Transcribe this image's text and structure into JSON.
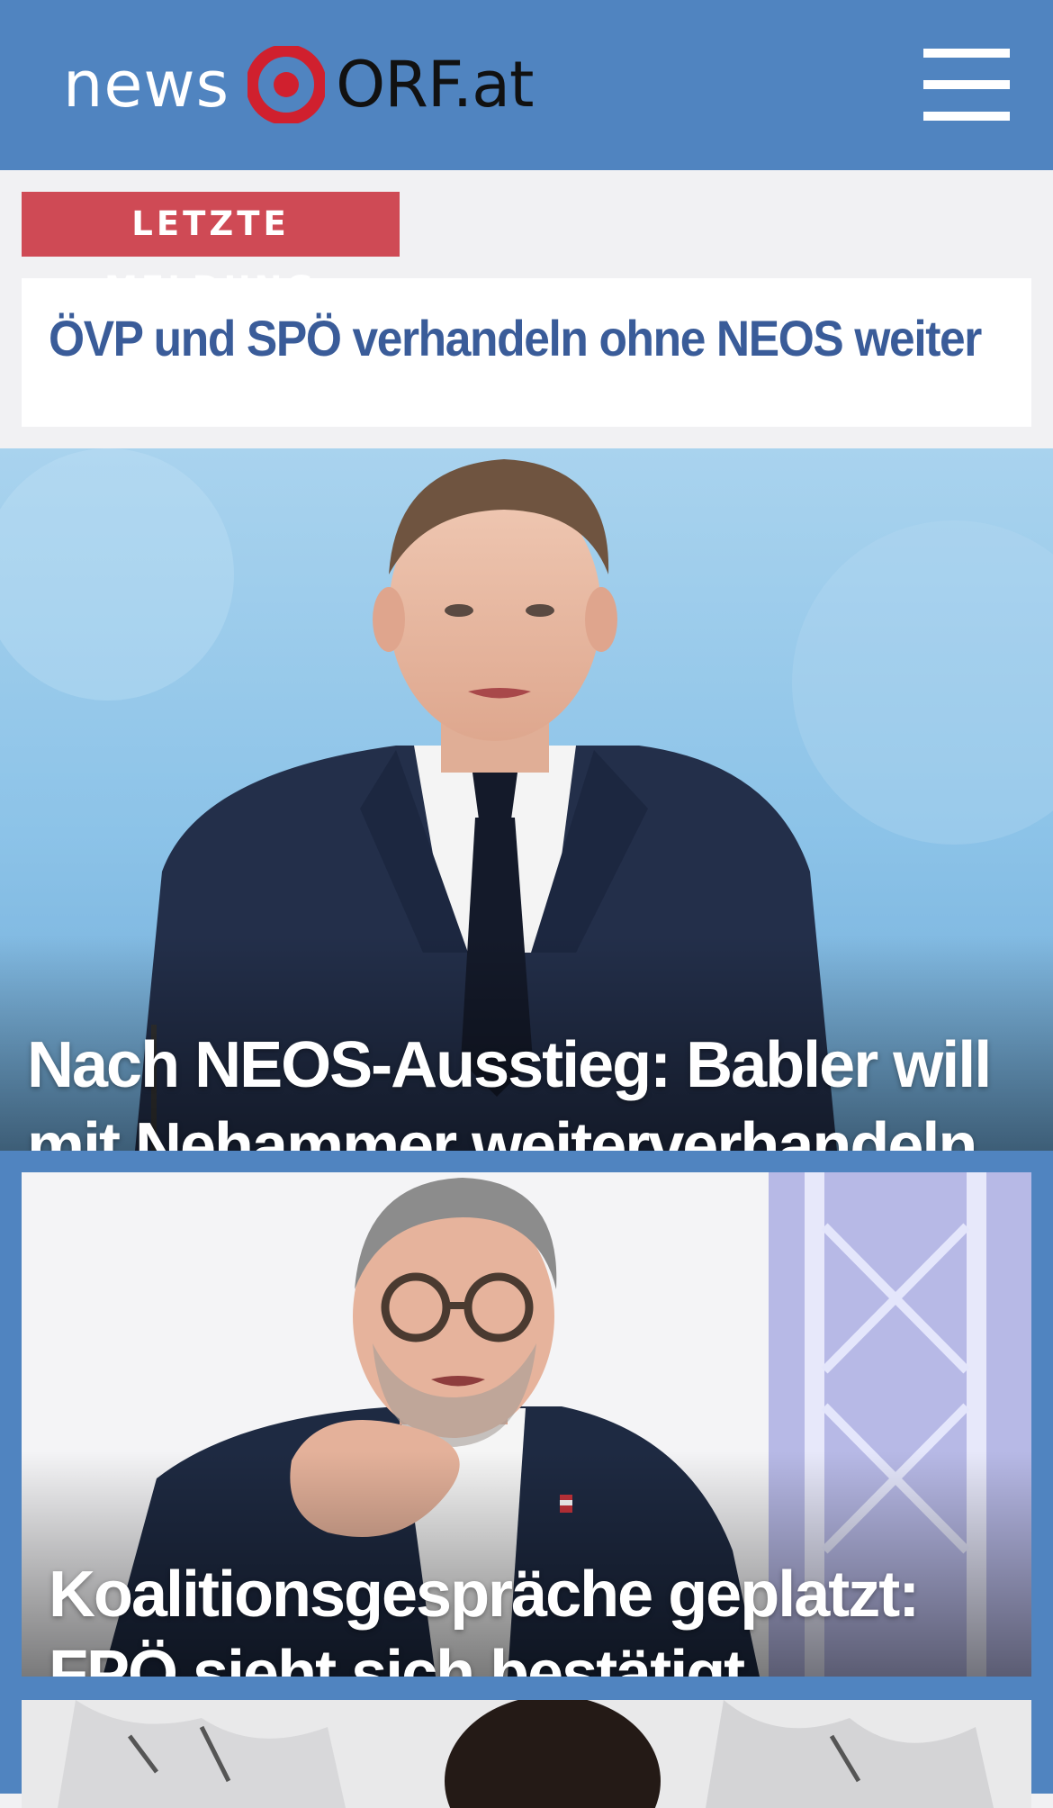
{
  "header": {
    "logo_news": "news",
    "logo_orf": "ORF.at",
    "menu_icon": "hamburger-menu-icon"
  },
  "breaking": {
    "badge": "LETZTE MELDUNG",
    "headline": "ÖVP und SPÖ verhandeln ohne NEOS weiter"
  },
  "stories": [
    {
      "headline": "Nach NEOS-Ausstieg: Babler will mit Nehammer weiterverhandeln"
    },
    {
      "headline": "Koalitionsgespräche geplatzt: FPÖ sieht sich bestätigt"
    }
  ],
  "colors": {
    "header_blue": "#5084c0",
    "breaking_red": "#cf4a55",
    "headline_blue": "#3a5c99",
    "orf_red": "#d0202e"
  }
}
